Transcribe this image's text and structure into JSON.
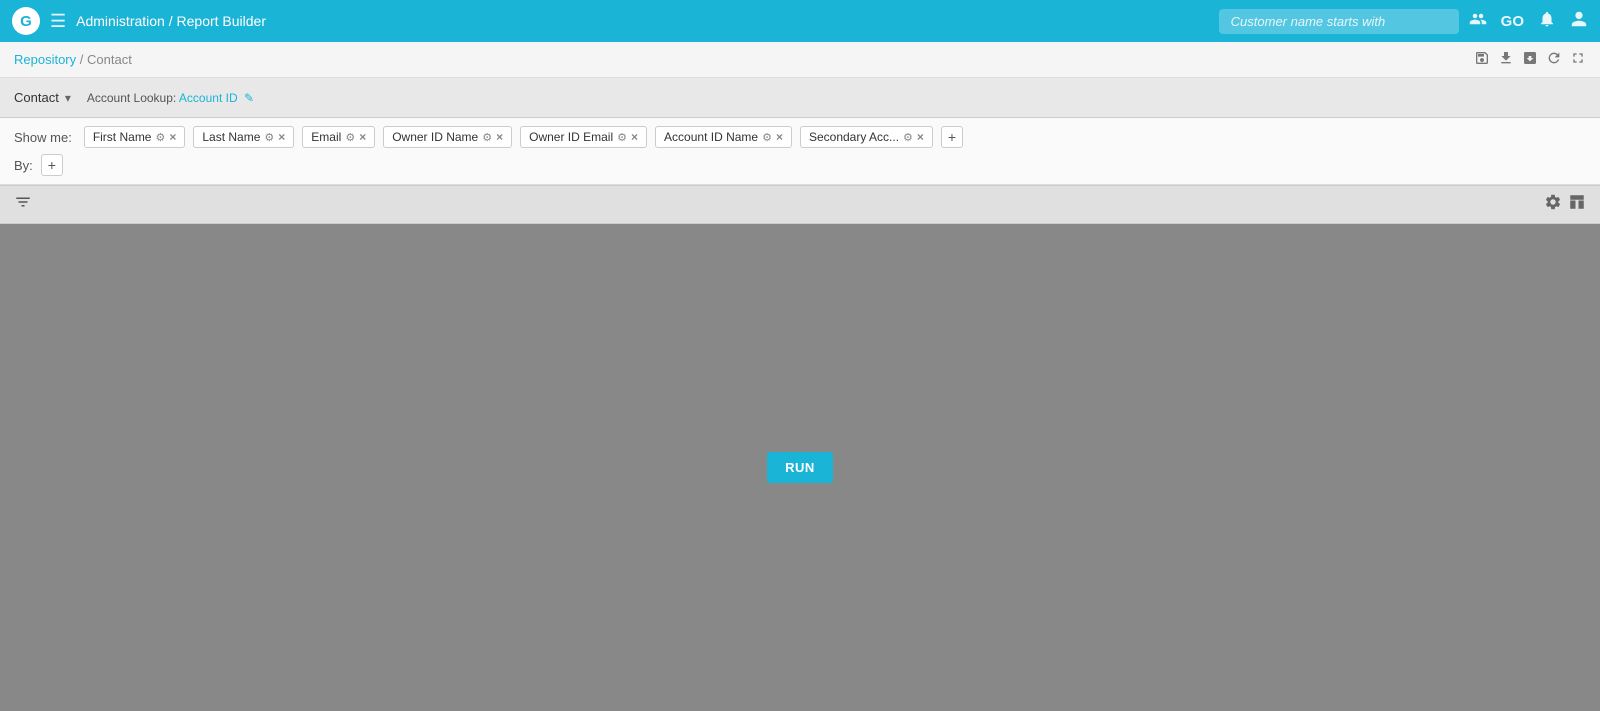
{
  "app": {
    "logo": "G",
    "nav_title": "Administration / Report Builder",
    "search_placeholder": "Customer name starts with"
  },
  "secondbar": {
    "breadcrumb_part1": "Repository",
    "breadcrumb_sep": " / ",
    "breadcrumb_part2": "Contact",
    "action_icons": [
      "save-icon",
      "export-icon",
      "import-icon",
      "refresh-icon",
      "settings-icon"
    ]
  },
  "fields": {
    "show_me_label": "Show me:",
    "by_label": "By:",
    "tags": [
      {
        "label": "First Name",
        "id": "first-name"
      },
      {
        "label": "Last Name",
        "id": "last-name"
      },
      {
        "label": "Email",
        "id": "email"
      },
      {
        "label": "Owner ID Name",
        "id": "owner-id-name"
      },
      {
        "label": "Owner ID Email",
        "id": "owner-id-email"
      },
      {
        "label": "Account ID Name",
        "id": "account-id-name"
      },
      {
        "label": "Secondary Acc...",
        "id": "secondary-acc"
      }
    ],
    "add_label": "+"
  },
  "contact": {
    "selector_label": "Contact",
    "lookup_prefix": "Account Lookup:",
    "lookup_value": "Account ID",
    "edit_icon": "✎"
  },
  "filter_toolbar": {
    "filter_icon": "⊘",
    "table_icon": "⊞"
  },
  "results": {
    "run_label": "RUN"
  },
  "icons": {
    "hamburger": "☰",
    "search": "🔍",
    "people": "👥",
    "bell": "🔔",
    "user": "👤",
    "gear": "⚙",
    "close": "×",
    "plus": "+",
    "chevron_down": "▾",
    "pencil": "✎",
    "save": "💾",
    "grid": "⊞",
    "filter": "⊘",
    "refresh": "↺",
    "arrow_right": "↗"
  }
}
